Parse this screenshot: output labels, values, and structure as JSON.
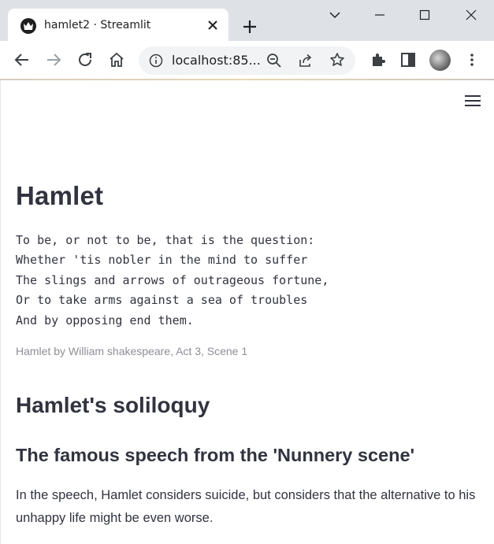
{
  "browser": {
    "tab_title": "hamlet2 · Streamlit",
    "url": "localhost:85...",
    "icons": {
      "favicon": "streamlit-crown-icon",
      "close": "close-icon",
      "new_tab": "plus-icon",
      "minimize": "minimize-icon",
      "maximize": "maximize-icon",
      "window_close": "window-close-icon",
      "tab_search": "chevron-down-icon",
      "back": "back-arrow-icon",
      "forward": "forward-arrow-icon",
      "reload": "reload-icon",
      "home": "home-icon",
      "site_info": "info-icon",
      "zoom": "zoom-out-icon",
      "share": "share-icon",
      "bookmark": "star-icon",
      "extensions": "puzzle-icon",
      "side_panel": "side-panel-icon",
      "menu": "kebab-menu-icon"
    }
  },
  "app": {
    "menu_icon": "hamburger-menu-icon",
    "title": "Hamlet",
    "poem": "To be, or not to be, that is the question:\nWhether 'tis nobler in the mind to suffer\nThe slings and arrows of outrageous fortune,\nOr to take arms against a sea of troubles\nAnd by opposing end them.",
    "caption": "Hamlet by William shakespeare, Act 3, Scene 1",
    "header": "Hamlet's soliloquy",
    "subheader": "The famous speech from the 'Nunnery scene'",
    "paragraph": "In the speech, Hamlet considers suicide, but considers that the alternative to his unhappy life might be even worse."
  },
  "colors": {
    "text": "#31333f",
    "caption": "#8c8f95",
    "chrome_bg": "#dee1e6",
    "omnibox_bg": "#f1f3f4"
  }
}
